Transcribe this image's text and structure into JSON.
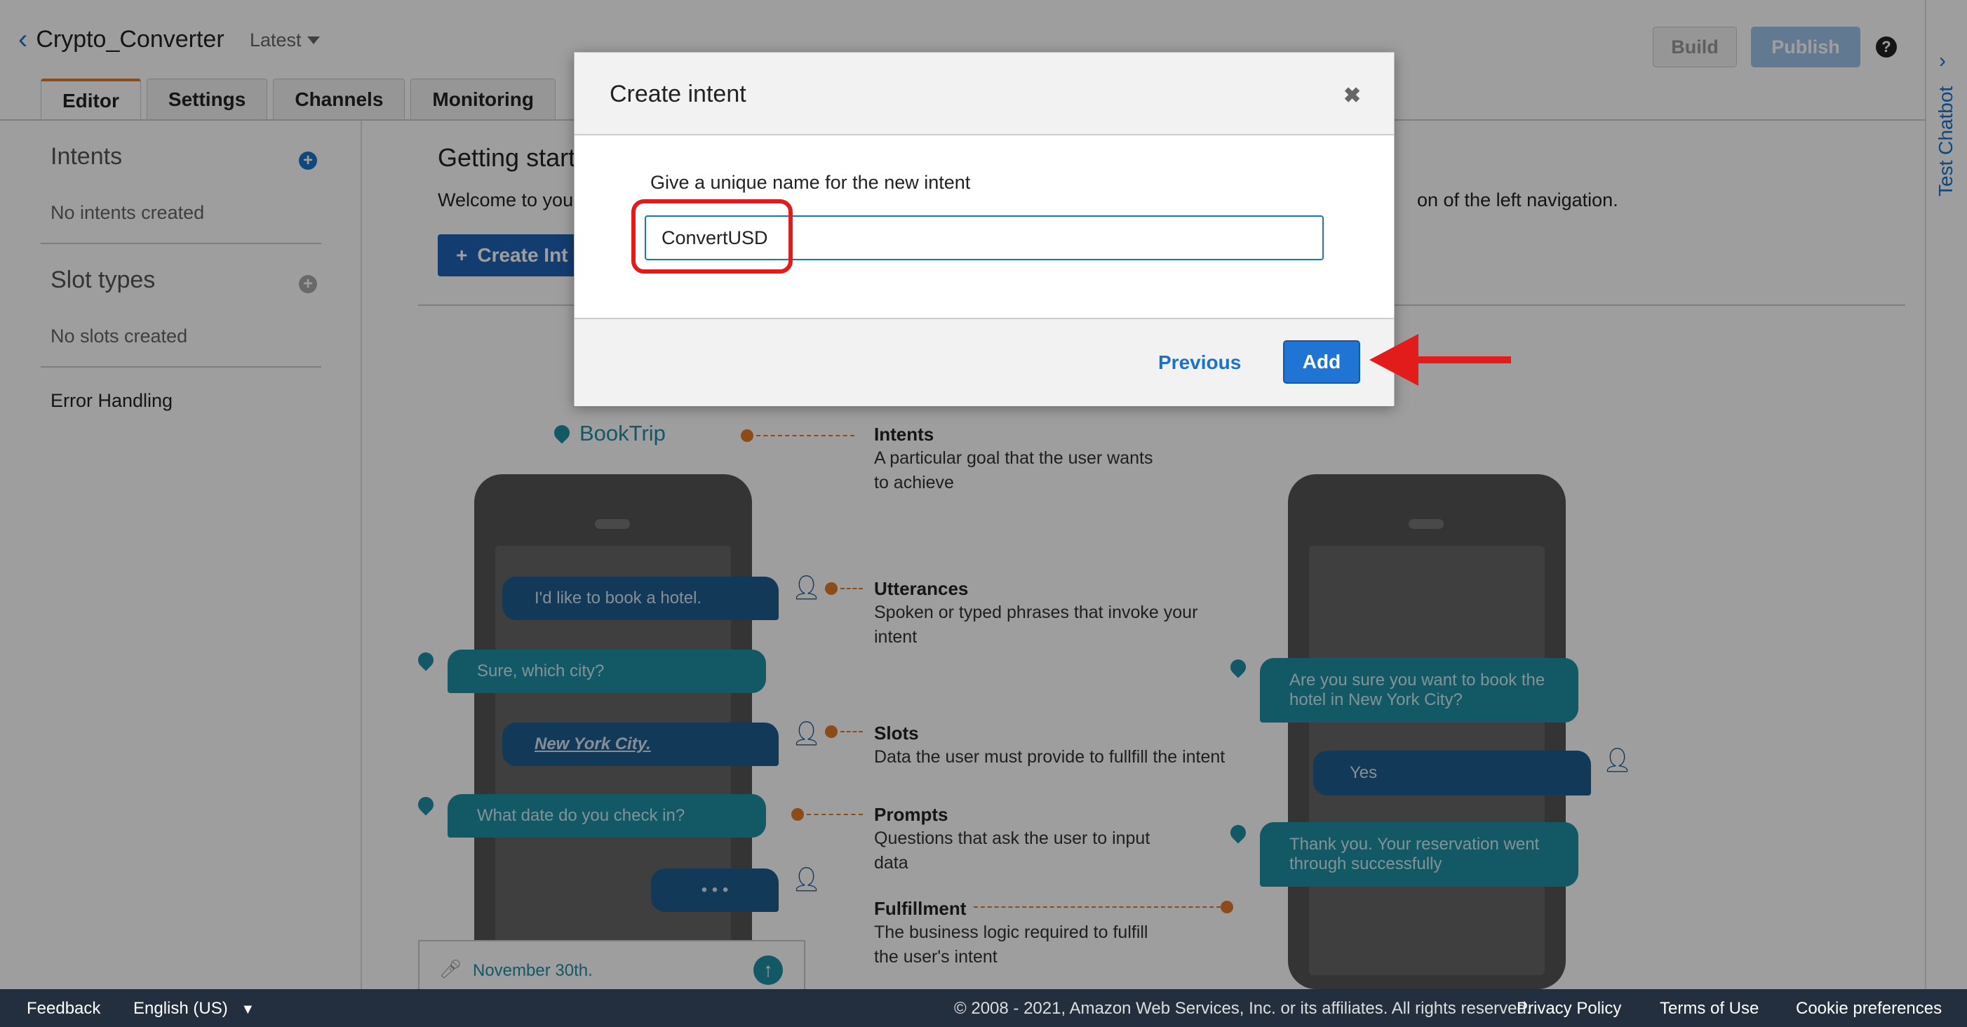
{
  "header": {
    "bot_name": "Crypto_Converter",
    "version": "Latest",
    "build_label": "Build",
    "publish_label": "Publish",
    "help_glyph": "?"
  },
  "tabs": [
    {
      "label": "Editor",
      "active": true
    },
    {
      "label": "Settings",
      "active": false
    },
    {
      "label": "Channels",
      "active": false
    },
    {
      "label": "Monitoring",
      "active": false
    }
  ],
  "right_rail": {
    "label": "Test Chatbot"
  },
  "sidebar": {
    "intents_heading": "Intents",
    "intents_empty": "No intents created",
    "slot_types_heading": "Slot types",
    "slots_empty": "No slots created",
    "error_handling": "Error Handling"
  },
  "main": {
    "heading": "Getting start",
    "welcome_start": "Welcome to you",
    "welcome_tail": "on of the left navigation.",
    "create_button": "Create Int"
  },
  "illustration": {
    "intent_name": "BookTrip",
    "left_chat": [
      {
        "who": "user",
        "text": "I'd like to book a hotel."
      },
      {
        "who": "bot",
        "text": "Sure, which city?"
      },
      {
        "who": "user",
        "text": "New York City."
      },
      {
        "who": "bot",
        "text": "What date do you check in?"
      },
      {
        "who": "user",
        "text": "• • •"
      }
    ],
    "input_text": "November 30th.",
    "right_chat": [
      {
        "who": "bot",
        "text": "Are you sure you want to book the hotel in New York City?"
      },
      {
        "who": "user",
        "text": "Yes"
      },
      {
        "who": "bot",
        "text": "Thank you. Your reservation went through successfully"
      }
    ],
    "labels": [
      {
        "title": "Intents",
        "desc": "A particular goal that the user wants to achieve"
      },
      {
        "title": "Utterances",
        "desc": "Spoken or typed phrases that invoke your intent"
      },
      {
        "title": "Slots",
        "desc": "Data the user must provide to fullfill the intent"
      },
      {
        "title": "Prompts",
        "desc": "Questions that ask the user to input data"
      },
      {
        "title": "Fulfillment",
        "desc": "The business logic required to fulfill the user's intent"
      }
    ]
  },
  "modal": {
    "title": "Create intent",
    "close_glyph": "✖",
    "field_label": "Give a unique name for the new intent",
    "field_value": "ConvertUSD",
    "previous_label": "Previous",
    "add_label": "Add"
  },
  "footer": {
    "feedback": "Feedback",
    "language": "English (US)",
    "copyright": "© 2008 - 2021, Amazon Web Services, Inc. or its affiliates. All rights reserved.",
    "privacy": "Privacy Policy",
    "terms": "Terms of Use",
    "cookies": "Cookie preferences"
  },
  "colors": {
    "accent_blue": "#1a73c8",
    "annotation_red": "#e21b1b",
    "footer_bg": "#232f3e",
    "tab_active_border": "#e07b2a"
  }
}
